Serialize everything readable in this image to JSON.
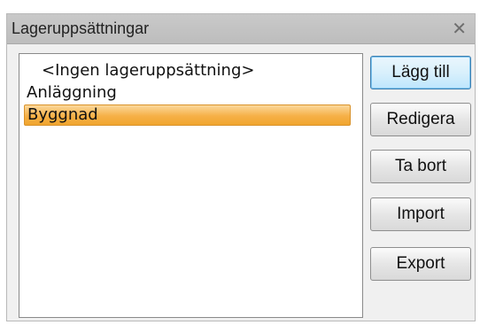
{
  "window": {
    "title": "Lageruppsättningar",
    "close_glyph": "✕"
  },
  "list": {
    "items": [
      {
        "label": "<Ingen lageruppsättning>",
        "selected": false
      },
      {
        "label": "Anläggning",
        "selected": false
      },
      {
        "label": "Byggnad",
        "selected": true
      }
    ]
  },
  "buttons": {
    "add": "Lägg till",
    "edit": "Redigera",
    "remove": "Ta bort",
    "import": "Import",
    "export": "Export"
  },
  "colors": {
    "selection": "#f6b047",
    "title_bar": "#c4c4c4"
  }
}
